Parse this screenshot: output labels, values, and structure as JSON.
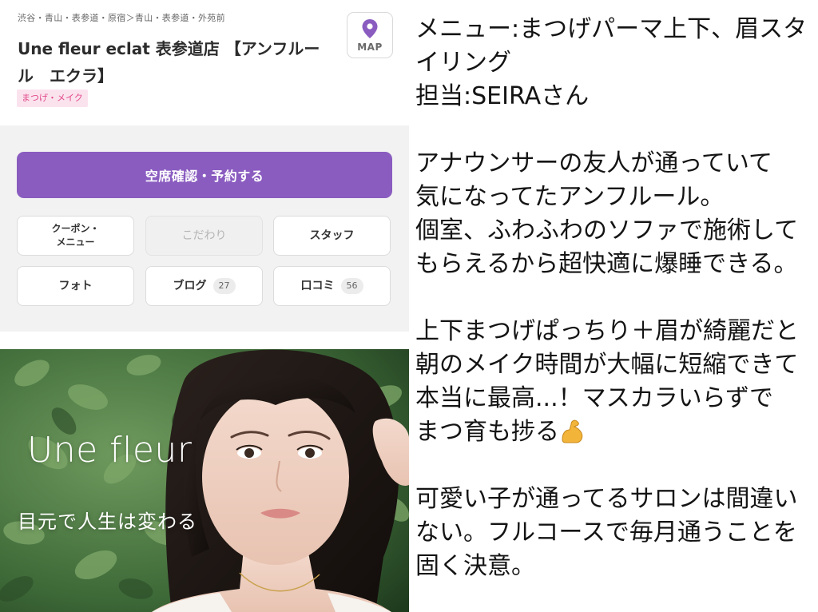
{
  "salon": {
    "area": "渋谷・青山・表参道・原宿＞青山・表参道・外苑前",
    "name_line1": "Une fleur eclat 表参道店 【アンフルー",
    "name_line2": "ル　エクラ】",
    "genre_tag": "まつげ・メイク",
    "map_label": "MAP",
    "reserve_label": "空席確認・予約する",
    "tiles": {
      "coupon_line1": "クーポン・",
      "coupon_line2": "メニュー",
      "kodawari": "こだわり",
      "staff": "スタッフ",
      "photo": "フォト",
      "blog": "ブログ",
      "blog_count": "27",
      "review": "口コミ",
      "review_count": "56"
    }
  },
  "banner": {
    "logo": "Une fleur",
    "slogan": "目元で人生は変わる"
  },
  "review_text": {
    "menu_line1": "メニュー:まつげパーマ上下、眉スタ",
    "menu_line2": "イリング",
    "staff_line": "担当:SEIRAさん",
    "p1_line1": "アナウンサーの友人が通っていて",
    "p1_line2": "気になってたアンフルール。",
    "p1_line3": "個室、ふわふわのソファで施術して",
    "p1_line4": "もらえるから超快適に爆睡できる。",
    "p2_line1": "上下まつげぱっちり＋眉が綺麗だと",
    "p2_line2": "朝のメイク時間が大幅に短縮できて",
    "p2_line3": "本当に最高...！マスカラいらずで",
    "p2_line4": "まつ育も捗る",
    "p3_line1": "可愛い子が通ってるサロンは間違い",
    "p3_line2": "ない。フルコースで毎月通うことを",
    "p3_line3": "固く決意。"
  },
  "icons": {
    "map_pin": "map-pin-icon",
    "emoji": "flexed-biceps-emoji"
  },
  "colors": {
    "accent_purple": "#8a5cc0",
    "tag_pink": "#e14a8a",
    "tag_pink_bg": "#fbe3ee"
  }
}
